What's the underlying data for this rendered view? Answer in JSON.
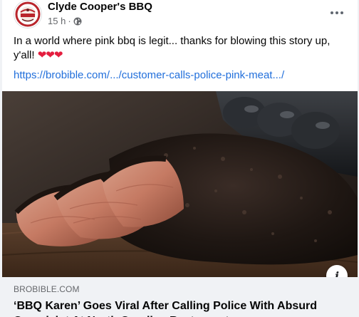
{
  "post": {
    "page_name": "Clyde Cooper's BBQ",
    "timestamp": "15 h",
    "separator": "·",
    "privacy_icon": "globe-icon",
    "text": "In a world where pink bbq is legit... thanks for blowing this story up, y'all!",
    "emoji": "❤❤❤",
    "link_text": "https://brobible.com/.../customer-calls-police-pink-meat.../",
    "more_icon": "more-horizontal-icon"
  },
  "link_preview": {
    "domain": "BROBIBLE.COM",
    "headline": "‘BBQ Karen’ Goes Viral After Calling Police With Absurd Complaint At North Carolina Restaurant",
    "info_icon": "info-icon",
    "info_glyph": "i",
    "image_subject": "sliced smoked brisket"
  },
  "colors": {
    "link": "#216fdb",
    "heart": "#e41e3f",
    "footer_bg": "#f0f2f5",
    "text": "#050505",
    "meta": "#65676b"
  }
}
